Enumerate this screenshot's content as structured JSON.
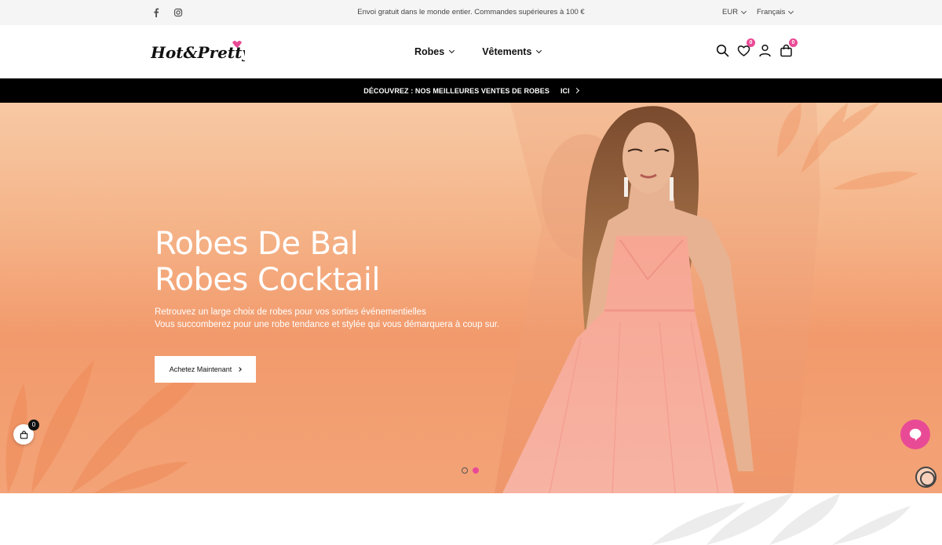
{
  "topbar": {
    "social": [
      "facebook-icon",
      "instagram-icon"
    ],
    "promo": "Envoi gratuit dans le monde entier. Commandes supérieures à 100 €",
    "currency": "EUR",
    "language": "Français"
  },
  "header": {
    "logo_text": "Hot&Pretty",
    "nav": [
      {
        "label": "Robes"
      },
      {
        "label": "Vêtements"
      }
    ],
    "wishlist_count": "0",
    "cart_count": "0",
    "icons": [
      "search-icon",
      "heart-icon",
      "user-icon",
      "bag-icon"
    ]
  },
  "announcement": {
    "text": "DÉCOUVREZ : NOS MEILLEURES VENTES DE ROBES",
    "link": "ICI"
  },
  "hero": {
    "title_line1": "Robes De Bal",
    "title_line2": "Robes Cocktail",
    "sub_line1": "Retrouvez un large choix de robes pour vos sorties événementielles",
    "sub_line2": "Vous succomberez pour une robe tendance et stylée qui vous démarquera à coup sur.",
    "cta": "Achetez Maintenant",
    "slides": 2,
    "active_slide": 2
  },
  "floating": {
    "cart_count": "0"
  },
  "colors": {
    "accent": "#e94a95",
    "announce_bg": "#000000",
    "topbar_bg": "#f5f5f5"
  }
}
